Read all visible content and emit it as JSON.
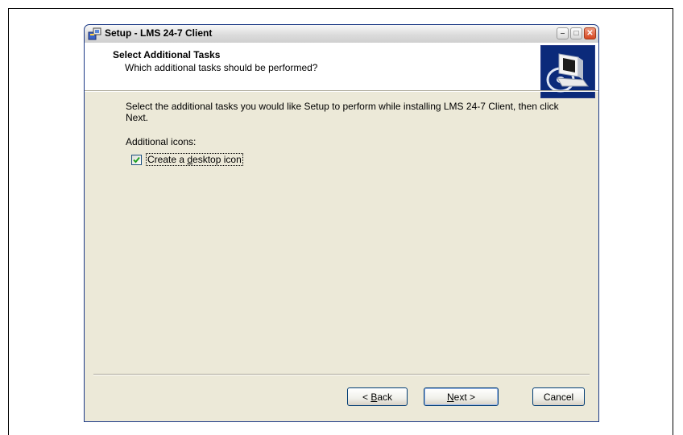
{
  "window": {
    "title": "Setup - LMS 24-7 Client",
    "icons": {
      "app": "setup-installer-icon",
      "minimize": "minimize-icon",
      "maximize": "maximize-icon",
      "close": "close-icon"
    }
  },
  "header": {
    "title": "Select Additional Tasks",
    "subtitle": "Which additional tasks should be performed?",
    "image": "computer-cd-wizard-icon"
  },
  "body": {
    "instructions": "Select the additional tasks you would like Setup to perform while installing LMS 24-7 Client, then click Next.",
    "section_label": "Additional icons:",
    "tasks": [
      {
        "label_prefix": "Create a ",
        "label_accel": "d",
        "label_suffix": "esktop icon",
        "checked": true
      }
    ]
  },
  "buttons": {
    "back": {
      "prefix": "< ",
      "accel": "B",
      "suffix": "ack"
    },
    "next": {
      "prefix": "",
      "accel": "N",
      "suffix": "ext >"
    },
    "cancel": "Cancel"
  },
  "colors": {
    "client_bg": "#ece9d8",
    "header_bg": "#ffffff",
    "checkmark": "#21a121",
    "close_button": "#d6451f"
  }
}
